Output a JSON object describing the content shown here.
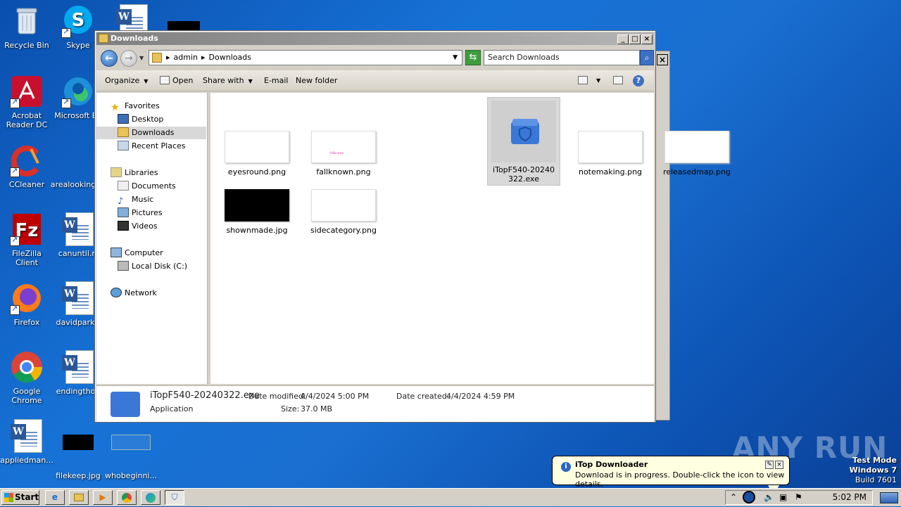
{
  "desktop": {
    "icons": [
      {
        "label": "Recycle Bin"
      },
      {
        "label": "Skype"
      },
      {
        "label": "Acrobat Reader DC"
      },
      {
        "label": "Microsoft Ed"
      },
      {
        "label": "CCleaner"
      },
      {
        "label": "arealooking"
      },
      {
        "label": "FileZilla Client"
      },
      {
        "label": "canuntil.rt"
      },
      {
        "label": "Firefox"
      },
      {
        "label": "davidpark.r"
      },
      {
        "label": "Google Chrome"
      },
      {
        "label": "endingthou"
      },
      {
        "label": "appliedman..."
      },
      {
        "label": "filekeep.jpg"
      },
      {
        "label": "whobeginni..."
      }
    ]
  },
  "window": {
    "title": "Downloads",
    "address": {
      "crumbs": [
        "admin",
        "Downloads"
      ]
    },
    "search_placeholder": "Search Downloads",
    "toolbar": {
      "organize": "Organize",
      "open": "Open",
      "share_with": "Share with",
      "email": "E-mail",
      "new_folder": "New folder"
    },
    "nav": {
      "favorites": "Favorites",
      "desktop": "Desktop",
      "downloads": "Downloads",
      "recent": "Recent Places",
      "libraries": "Libraries",
      "documents": "Documents",
      "music": "Music",
      "pictures": "Pictures",
      "videos": "Videos",
      "computer": "Computer",
      "local_disk": "Local Disk (C:)",
      "network": "Network"
    },
    "files": [
      {
        "name": "eyesround.png"
      },
      {
        "name": "fallknown.png",
        "thumb_text": "fallknown"
      },
      {
        "name": "iTopF540-20240322.exe"
      },
      {
        "name": "notemaking.png"
      },
      {
        "name": "releasedmap.png"
      },
      {
        "name": "shownmade.jpg"
      },
      {
        "name": "sidecategory.png"
      }
    ],
    "details": {
      "filename": "iTopF540-20240322.exe",
      "type": "Application",
      "modified_label": "Date modified:",
      "modified": "4/4/2024 5:00 PM",
      "size_label": "Size:",
      "size": "37.0 MB",
      "created_label": "Date created:",
      "created": "4/4/2024 4:59 PM"
    }
  },
  "balloon": {
    "title": "iTop Downloader",
    "message": "Download is in progress. Double-click the icon to view details."
  },
  "taskbar": {
    "start": "Start",
    "clock": "5:02 PM"
  },
  "watermark": {
    "text": "ANY RUN",
    "mode": "Test Mode",
    "os": "Windows 7",
    "build": "Build 7601"
  }
}
